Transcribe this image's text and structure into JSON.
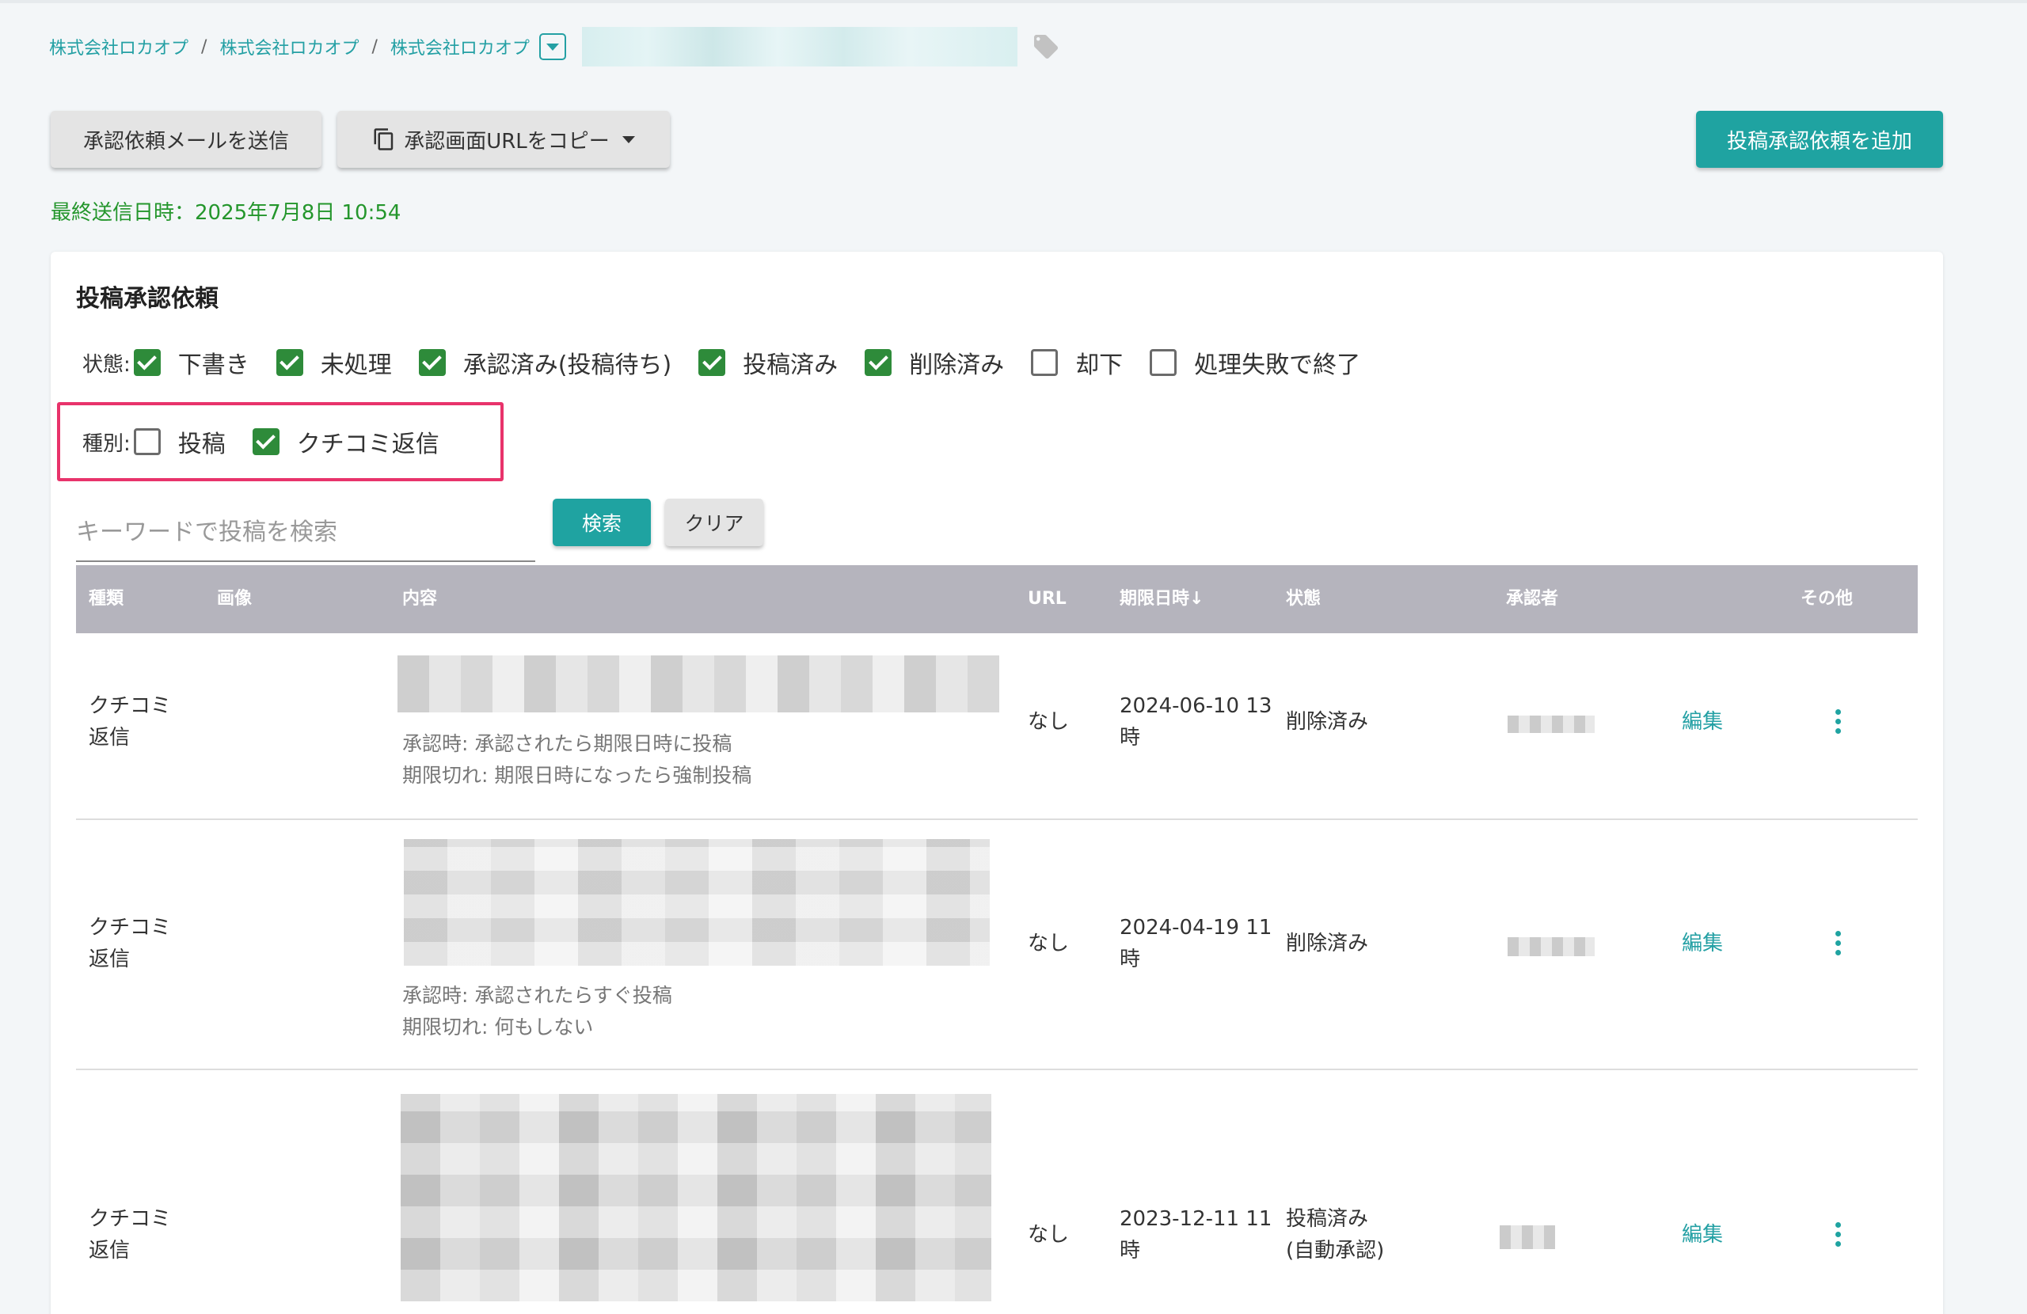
{
  "breadcrumb": {
    "items": [
      "株式会社ロカオプ",
      "株式会社ロカオプ",
      "株式会社ロカオプ"
    ],
    "separator": "/"
  },
  "toolbar": {
    "send_mail_label": "承認依頼メールを送信",
    "copy_url_label": "承認画面URLをコピー",
    "add_request_label": "投稿承認依頼を追加"
  },
  "last_sent": "最終送信日時：2025年7月8日 10:54",
  "card": {
    "title": "投稿承認依頼",
    "status_filter": {
      "label": "状態:",
      "options": [
        {
          "label": "下書き",
          "checked": true
        },
        {
          "label": "未処理",
          "checked": true
        },
        {
          "label": "承認済み(投稿待ち)",
          "checked": true
        },
        {
          "label": "投稿済み",
          "checked": true
        },
        {
          "label": "削除済み",
          "checked": true
        },
        {
          "label": "却下",
          "checked": false
        },
        {
          "label": "処理失敗で終了",
          "checked": false
        }
      ]
    },
    "type_filter": {
      "label": "種別:",
      "options": [
        {
          "label": "投稿",
          "checked": false
        },
        {
          "label": "クチコミ返信",
          "checked": true
        }
      ]
    },
    "search": {
      "placeholder": "キーワードで投稿を検索",
      "value": "",
      "search_label": "検索",
      "clear_label": "クリア"
    }
  },
  "table": {
    "columns": [
      "種類",
      "画像",
      "内容",
      "URL",
      "期限日時↓",
      "状態",
      "承認者",
      "その他"
    ],
    "edit_label": "編集",
    "rows": [
      {
        "type_line1": "クチコミ",
        "type_line2": "返信",
        "note_line1": "承認時: 承認されたら期限日時に投稿",
        "note_line2": "期限切れ: 期限日時になったら強制投稿",
        "url": "なし",
        "deadline_line1": "2024-06-10 13",
        "deadline_line2": "時",
        "status_line1": "削除済み",
        "status_line2": ""
      },
      {
        "type_line1": "クチコミ",
        "type_line2": "返信",
        "note_line1": "承認時: 承認されたらすぐ投稿",
        "note_line2": "期限切れ: 何もしない",
        "url": "なし",
        "deadline_line1": "2024-04-19 11",
        "deadline_line2": "時",
        "status_line1": "削除済み",
        "status_line2": ""
      },
      {
        "type_line1": "クチコミ",
        "type_line2": "返信",
        "note_line1": "",
        "note_line2": "",
        "url": "なし",
        "deadline_line1": "2023-12-11 11",
        "deadline_line2": "時",
        "status_line1": "投稿済み",
        "status_line2": "(自動承認)"
      }
    ]
  },
  "colors": {
    "accent": "#1fa3a1",
    "link": "#24a0a4",
    "checkbox": "#2e8b3a",
    "success_text": "#24962c",
    "highlight": "#e8336b",
    "table_header": "#b5b4bd"
  },
  "icons": [
    "chevron-down-icon",
    "tag-icon",
    "copy-icon",
    "caret-down-icon",
    "more-vert-icon",
    "checkbox-icon"
  ]
}
